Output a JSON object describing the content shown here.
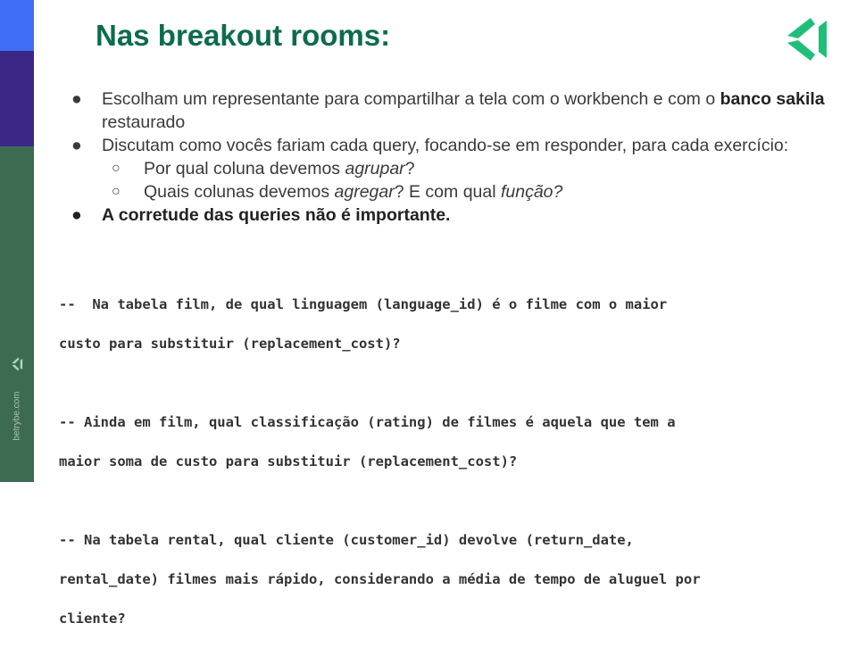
{
  "slide": {
    "title": "Nas breakout rooms:",
    "side_url": "betrybe.com",
    "colors": {
      "title": "#0d6b4e",
      "sidebar_blue": "#3f6ff6",
      "sidebar_purple": "#3c2787",
      "sidebar_green": "#3c6b52",
      "logo": "#1fbf7a"
    },
    "icons": {
      "brand_logo": "trybe-logo-icon",
      "sidebar_logo": "trybe-logo-small-icon"
    }
  },
  "bullets": {
    "b1": {
      "text1": "Escolham um representante para compartilhar a tela com o workbench e com o ",
      "bold": "banco sakila",
      "text2": " restaurado"
    },
    "b2": {
      "text": "Discutam como vocês fariam cada query, focando-se em responder, para cada exercício:"
    },
    "b2a": {
      "text1": "Por qual coluna devemos ",
      "italic": "agrupar",
      "text2": "?"
    },
    "b2b": {
      "text1": "Quais colunas devemos ",
      "italic1": "agregar",
      "text2": "? E com qual ",
      "italic2": "função?"
    },
    "b3": {
      "text": "A corretude das queries não é importante."
    },
    "bullet_char": "●",
    "sub_bullet_char": "○"
  },
  "code": {
    "q1_l1": "--  Na tabela film, de qual linguagem (language_id) é o filme com o maior",
    "q1_l2": "custo para substituir (replacement_cost)?",
    "q2_l1": "-- Ainda em film, qual classificação (rating) de filmes é aquela que tem a",
    "q2_l2": "maior soma de custo para substituir (replacement_cost)?",
    "q3_l1": "-- Na tabela rental, qual cliente (customer_id) devolve (return_date,",
    "q3_l2": "rental_date) filmes mais rápido, considerando a média de tempo de aluguel por",
    "q3_l3": "cliente?"
  }
}
